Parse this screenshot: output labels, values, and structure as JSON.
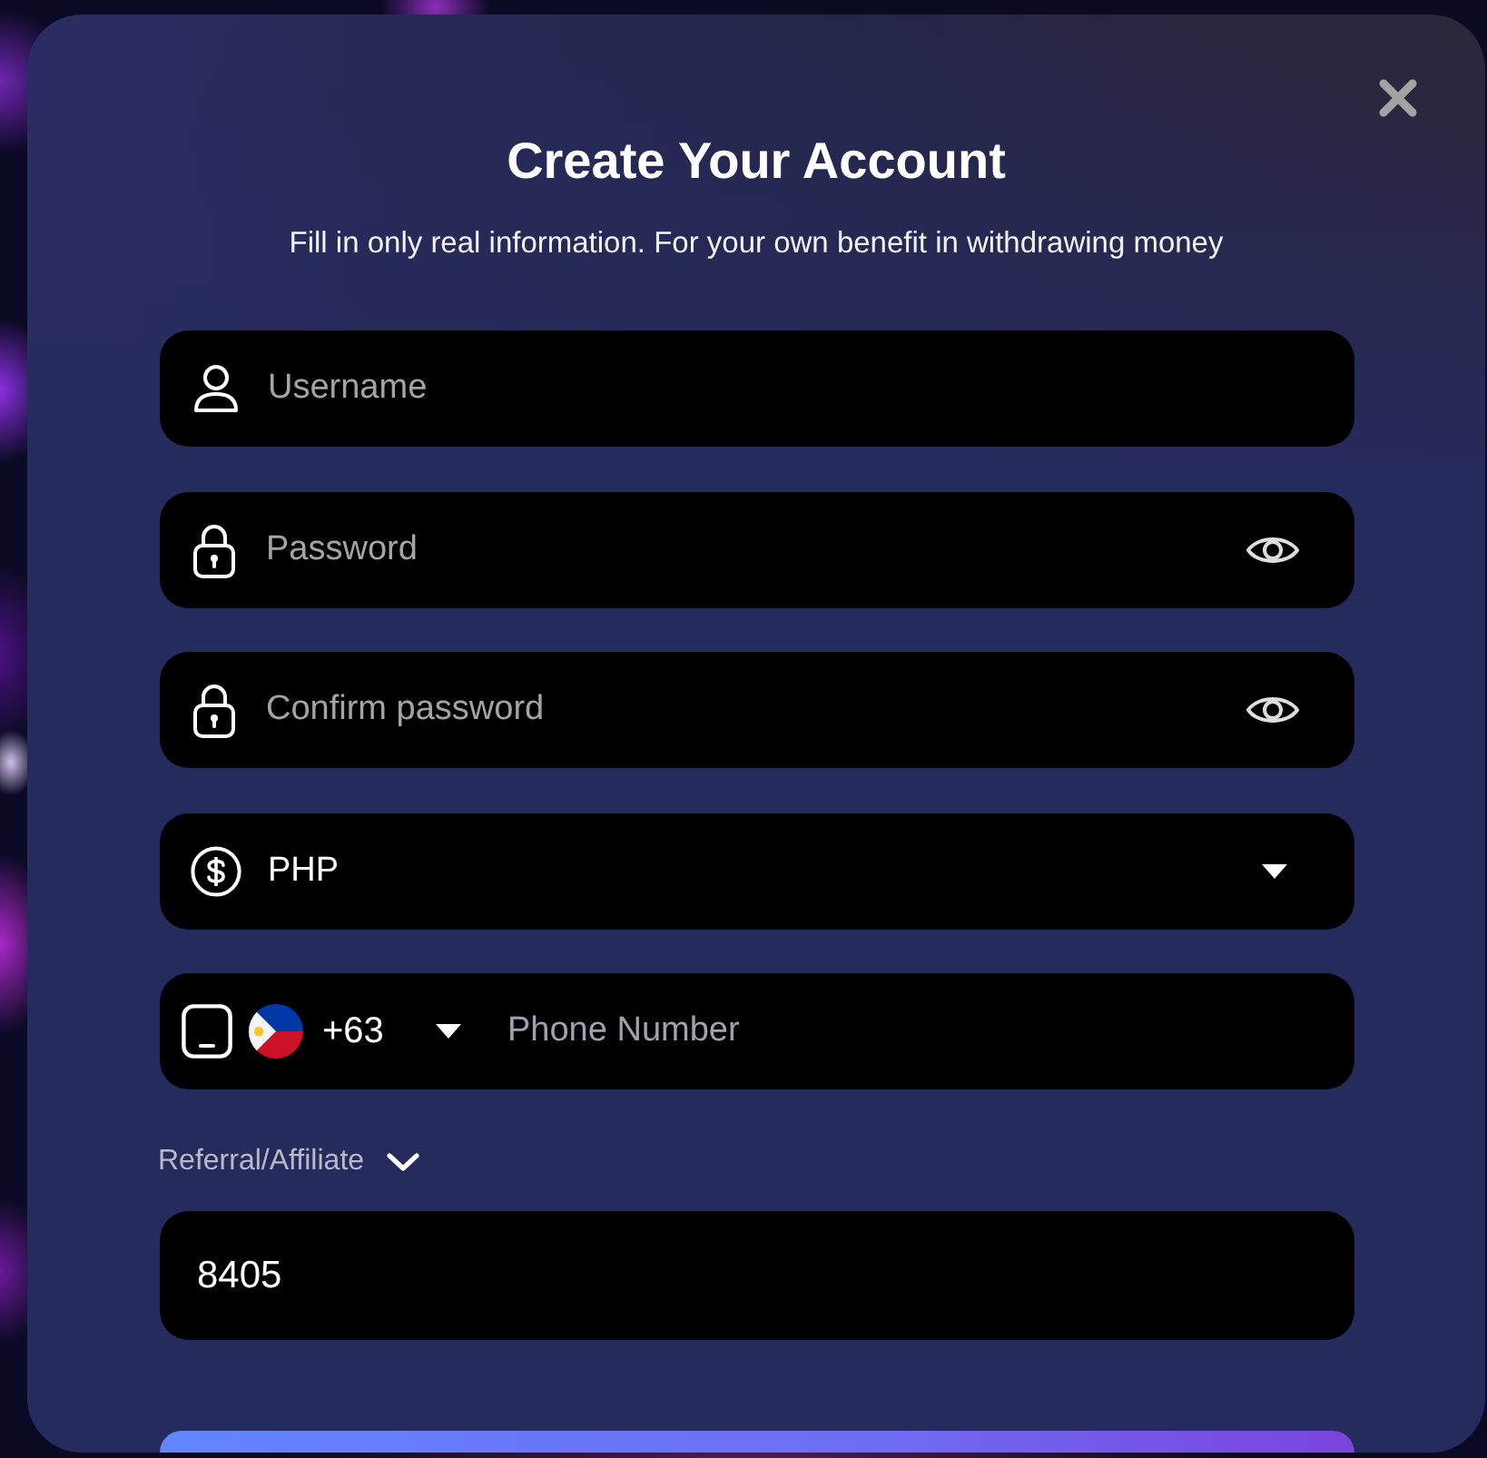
{
  "dialog": {
    "title": "Create Your Account",
    "subtitle": "Fill in only real information. For your own benefit in withdrawing money"
  },
  "fields": [
    {
      "kind": "username",
      "placeholder": "Username"
    },
    {
      "kind": "password",
      "placeholder": "Password"
    },
    {
      "kind": "password",
      "placeholder": "Confirm password"
    },
    {
      "kind": "currency",
      "value": "PHP"
    },
    {
      "kind": "phone",
      "country_code": "+63",
      "placeholder": "Phone Number"
    }
  ],
  "referral": {
    "label": "Referral/Affiliate",
    "expanded": true,
    "value": "8405"
  }
}
